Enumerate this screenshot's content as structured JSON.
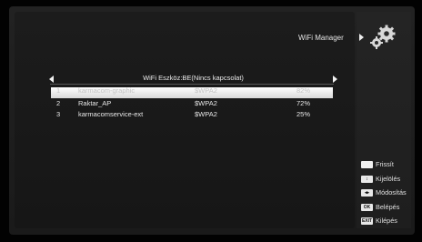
{
  "menu": {
    "title": "WiFi Manager",
    "icon": "gears-icon"
  },
  "device_header": {
    "text": "WiFi Eszköz:BE(Nincs kapcsolat)"
  },
  "networks": [
    {
      "index": "1",
      "ssid": "karmacom-graphic",
      "encryption": "$WPA2",
      "signal": "82%",
      "selected": true
    },
    {
      "index": "2",
      "ssid": "Raktar_AP",
      "encryption": "$WPA2",
      "signal": "72%",
      "selected": false
    },
    {
      "index": "3",
      "ssid": "karmacomservice-ext",
      "encryption": "$WPA2",
      "signal": "25%",
      "selected": false
    }
  ],
  "legend": [
    {
      "key_label": "",
      "label": "Frissít",
      "icon": "white-button-icon"
    },
    {
      "key_label": "↕",
      "label": "Kijelölés",
      "icon": "up-down-key-icon"
    },
    {
      "key_label": "◂▸",
      "label": "Módosítás",
      "icon": "left-right-key-icon"
    },
    {
      "key_label": "OK",
      "label": "Belépés",
      "icon": "ok-key-icon"
    },
    {
      "key_label": "EXIT",
      "label": "Kilépés",
      "icon": "exit-key-icon"
    }
  ]
}
